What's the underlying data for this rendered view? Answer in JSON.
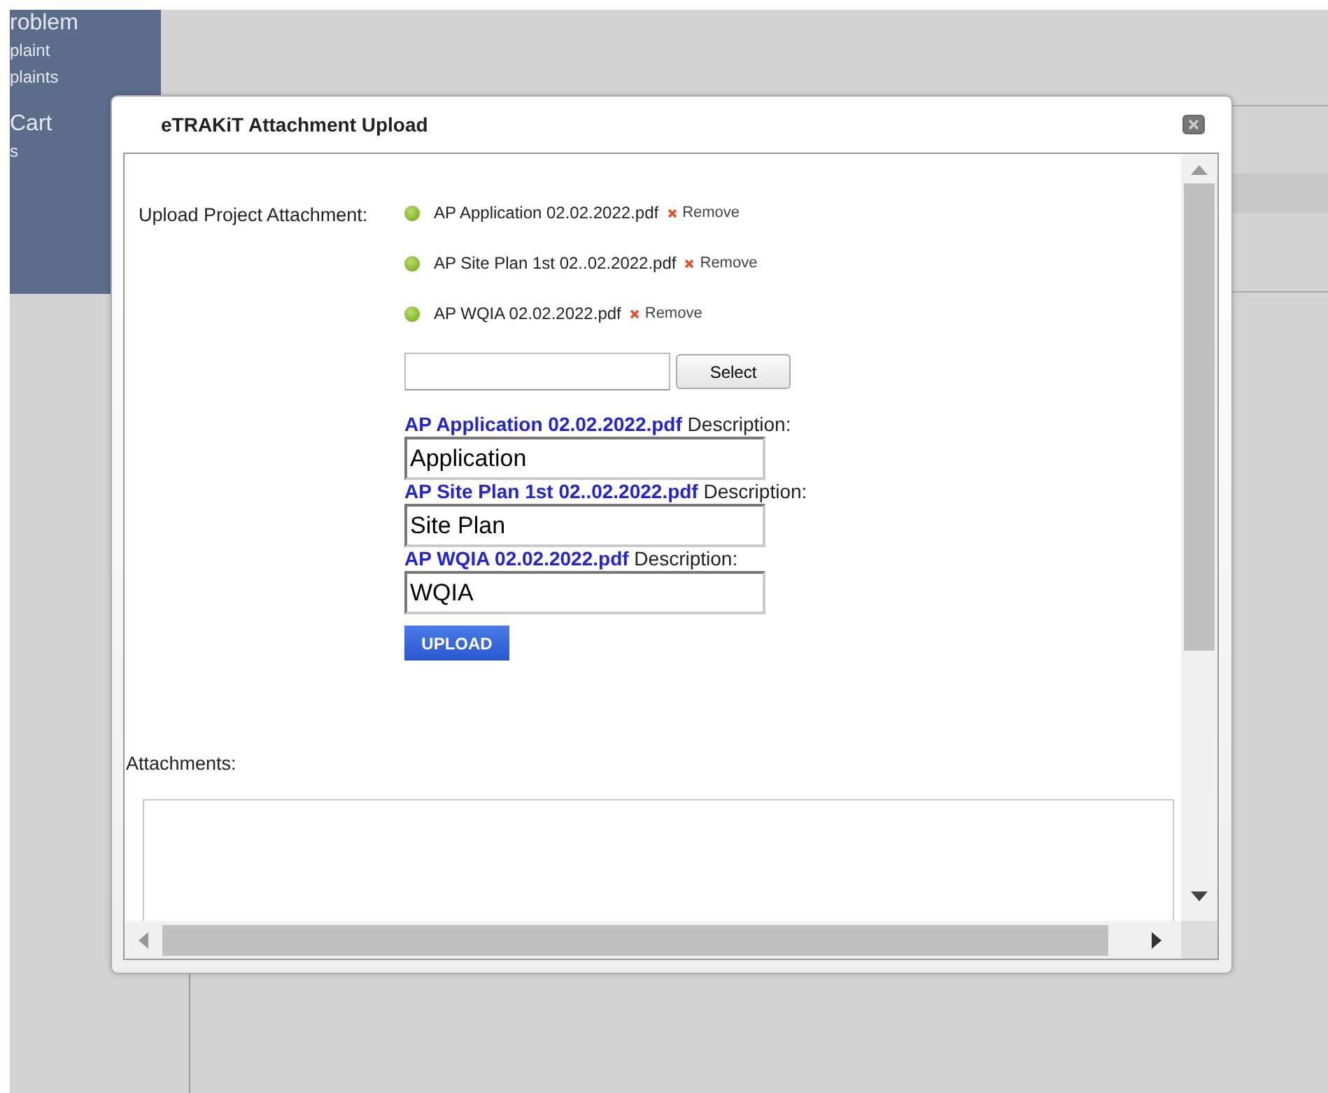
{
  "background": {
    "sidebar_items": [
      {
        "text": "roblem",
        "kind": "heading"
      },
      {
        "text": "plaint",
        "kind": "link"
      },
      {
        "text": "plaints",
        "kind": "link"
      },
      {
        "text": "Cart",
        "kind": "heading"
      },
      {
        "text": "s",
        "kind": "link"
      }
    ]
  },
  "dialog": {
    "title": "eTRAKiT Attachment Upload",
    "upload_label": "Upload Project Attachment:",
    "files": [
      {
        "name": "AP Application 02.02.2022.pdf",
        "remove": "Remove"
      },
      {
        "name": "AP Site Plan 1st 02..02.2022.pdf",
        "remove": "Remove"
      },
      {
        "name": "AP WQIA 02.02.2022.pdf",
        "remove": "Remove"
      }
    ],
    "select_button": "Select",
    "descriptions": [
      {
        "file": "AP Application 02.02.2022.pdf",
        "label": "Description:",
        "value": "Application"
      },
      {
        "file": "AP Site Plan 1st 02..02.2022.pdf",
        "label": "Description:",
        "value": "Site Plan"
      },
      {
        "file": "AP WQIA 02.02.2022.pdf",
        "label": "Description:",
        "value": "WQIA"
      }
    ],
    "upload_button": "UPLOAD",
    "attachments_label": "Attachments:"
  }
}
